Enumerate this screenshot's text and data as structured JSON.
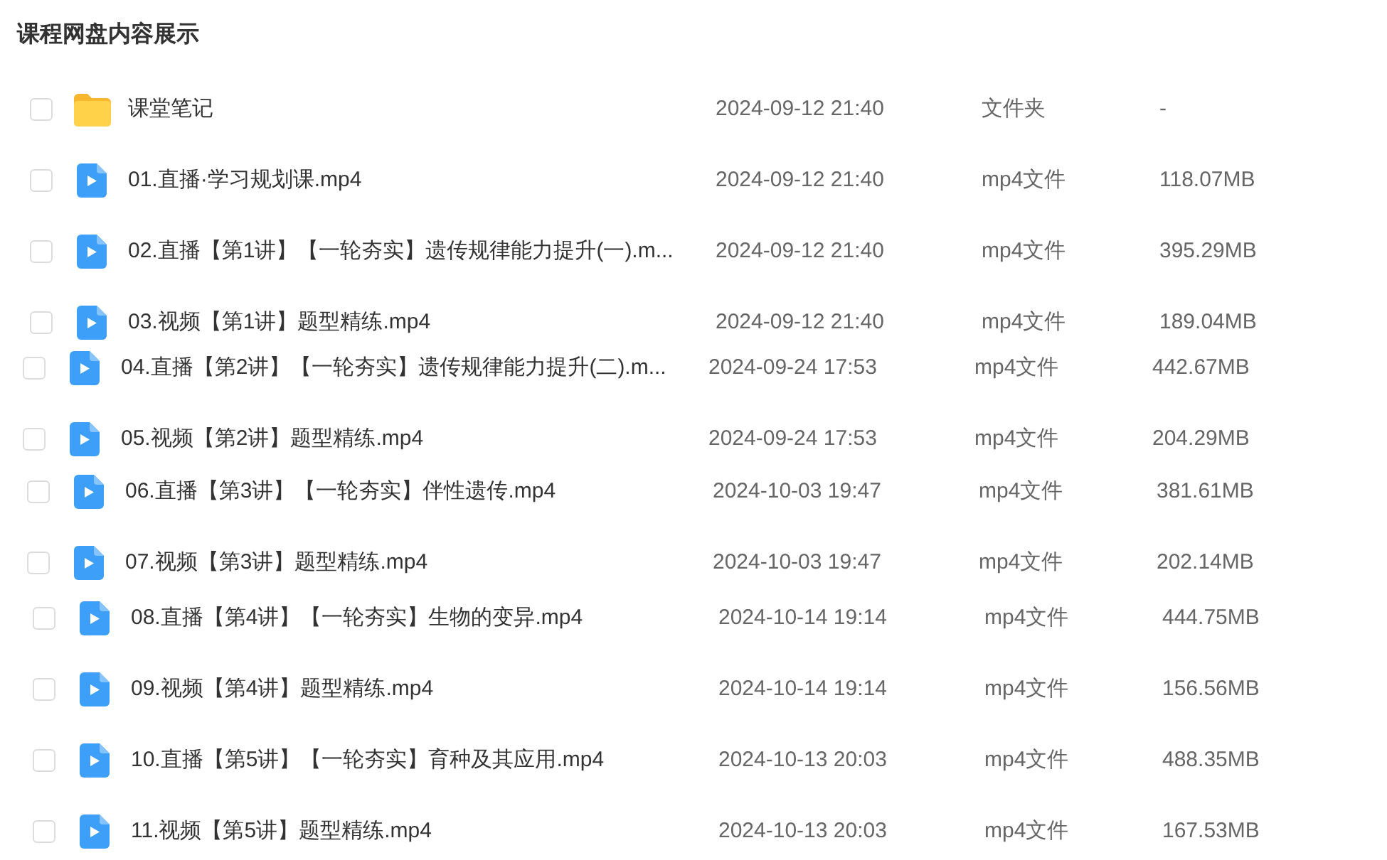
{
  "title": "课程网盘内容展示",
  "files": [
    {
      "kind": "folder",
      "checked": false,
      "name": "课堂笔记",
      "modified": "2024-09-12 21:40",
      "type": "文件夹",
      "size": "-"
    },
    {
      "kind": "video",
      "checked": false,
      "name": "01.直播·学习规划课.mp4",
      "modified": "2024-09-12 21:40",
      "type": "mp4文件",
      "size": "118.07MB"
    },
    {
      "kind": "video",
      "checked": false,
      "name": "02.直播【第1讲】【一轮夯实】遗传规律能力提升(一).m...",
      "modified": "2024-09-12 21:40",
      "type": "mp4文件",
      "size": "395.29MB"
    },
    {
      "kind": "video",
      "checked": false,
      "name": "03.视频【第1讲】题型精练.mp4",
      "modified": "2024-09-12 21:40",
      "type": "mp4文件",
      "size": "189.04MB"
    },
    {
      "kind": "video",
      "checked": false,
      "name": "04.直播【第2讲】【一轮夯实】遗传规律能力提升(二).m...",
      "modified": "2024-09-24 17:53",
      "type": "mp4文件",
      "size": "442.67MB"
    },
    {
      "kind": "video",
      "checked": false,
      "name": "05.视频【第2讲】题型精练.mp4",
      "modified": "2024-09-24 17:53",
      "type": "mp4文件",
      "size": "204.29MB"
    },
    {
      "kind": "video",
      "checked": false,
      "name": "06.直播【第3讲】【一轮夯实】伴性遗传.mp4",
      "modified": "2024-10-03 19:47",
      "type": "mp4文件",
      "size": "381.61MB"
    },
    {
      "kind": "video",
      "checked": false,
      "name": "07.视频【第3讲】题型精练.mp4",
      "modified": "2024-10-03 19:47",
      "type": "mp4文件",
      "size": "202.14MB"
    },
    {
      "kind": "video",
      "checked": false,
      "name": "08.直播【第4讲】【一轮夯实】生物的变异.mp4",
      "modified": "2024-10-14 19:14",
      "type": "mp4文件",
      "size": "444.75MB"
    },
    {
      "kind": "video",
      "checked": false,
      "name": "09.视频【第4讲】题型精练.mp4",
      "modified": "2024-10-14 19:14",
      "type": "mp4文件",
      "size": "156.56MB"
    },
    {
      "kind": "video",
      "checked": false,
      "name": "10.直播【第5讲】【一轮夯实】育种及其应用.mp4",
      "modified": "2024-10-13 20:03",
      "type": "mp4文件",
      "size": "488.35MB"
    },
    {
      "kind": "video",
      "checked": false,
      "name": "11.视频【第5讲】题型精练.mp4",
      "modified": "2024-10-13 20:03",
      "type": "mp4文件",
      "size": "167.53MB"
    }
  ]
}
